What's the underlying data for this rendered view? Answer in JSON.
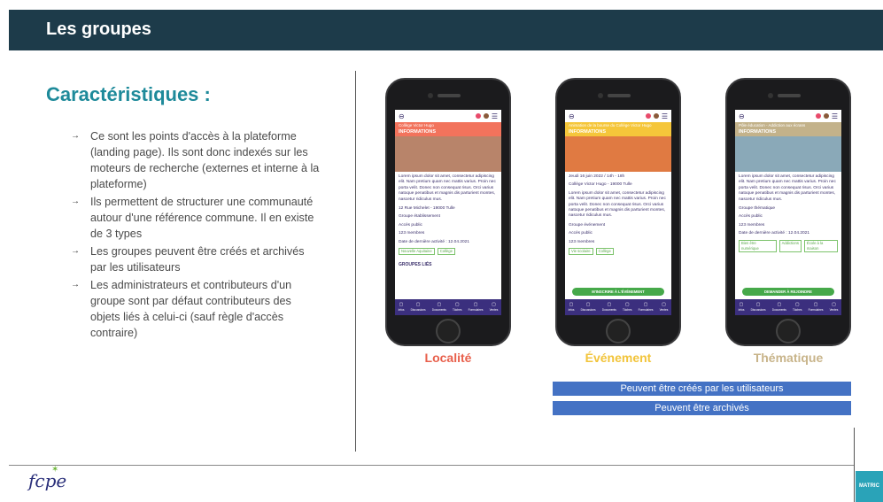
{
  "header": {
    "title": "Les groupes"
  },
  "section_title": "Caractéristiques :",
  "bullet_marker": "→",
  "bullets": [
    "Ce sont les points d'accès à la plateforme (landing page). Ils sont donc indexés sur les moteurs de recherche (externes et interne à la plateforme)",
    "Ils permettent de structurer une communauté autour d'une référence commune. Il en existe de 3 types",
    "Les groupes peuvent être créés et archivés par les utilisateurs",
    "Les administrateurs et contributeurs d'un groupe sont par défaut contributeurs des objets liés à celui-ci (sauf règle d'accès contraire)"
  ],
  "phones": [
    {
      "label": "Localité",
      "label_color": "#e8604c",
      "banner_color": "#f2735c",
      "crumb": "Collège Victor Hugo",
      "info": "INFORMATIONS",
      "image_color": "#b8846a",
      "lines": [
        "Lorem ipsum dolor sit amet, consectetur adipiscing elit. Nam pretium quam nec mattis varius. Proin nec porta velit. Donec non consequat risus. Orci varius natoque penatibus et magnis dis parturient montes, nascetur ridiculus mus."
      ],
      "meta": [
        "12 Rue Michelet - 19000 Tulle",
        "Groupe établissement",
        "Accès public",
        "123 membres",
        "Date de dernière activité : 12.04.2021"
      ],
      "tags": [
        "Nouvelle Aquitaine",
        "Collège"
      ],
      "extra": "GROUPES LIÉS",
      "cta": ""
    },
    {
      "label": "Événement",
      "label_color": "#f2c43a",
      "banner_color": "#f5c63a",
      "crumb": "Animation de la bourse du Collège Victor Hugo",
      "info": "INFORMATIONS",
      "image_color": "#e07a42",
      "lines": [
        "Jeudi 16 juin 2022 / 14h - 18h",
        "Collège Victor Hugo - 19000 Tulle",
        "Lorem ipsum dolor sit amet, consectetur adipiscing elit. Nam pretium quam nec mattis varius. Proin nec porta velit. Donec non consequat risus. Orci varius natoque penatibus et magnis dis parturient montes, nascetur ridiculus mus."
      ],
      "meta": [
        "Groupe événement",
        "Accès public",
        "123 membres"
      ],
      "tags": [
        "Vie scolaire",
        "Collège"
      ],
      "extra": "",
      "cta": "M'INSCRIRE À L'ÉVÉNEMENT"
    },
    {
      "label": "Thématique",
      "label_color": "#c8b48a",
      "banner_color": "#c3b28a",
      "crumb": "Pôle éducation - Addiction aux écrans",
      "info": "INFORMATIONS",
      "image_color": "#8aa9b8",
      "lines": [
        "Lorem ipsum dolor sit amet, consectetur adipiscing elit. Nam pretium quam nec mattis varius. Proin nec porta velit. Donec non consequat risus. Orci varius natoque penatibus et magnis dis parturient montes, nascetur ridiculus mus."
      ],
      "meta": [
        "Groupe thématique",
        "Accès public",
        "123 membres",
        "Date de dernière activité : 12.04.2021"
      ],
      "tags": [
        "Bien être numérique",
        "Addictions",
        "École à la maison"
      ],
      "extra": "",
      "cta": "DEMANDER À REJOINDRE"
    }
  ],
  "nav_items": [
    "Infos",
    "Discussions",
    "Documents",
    "Tâches",
    "Formulaires",
    "Ventes"
  ],
  "bars": [
    "Peuvent être créés par les utilisateurs",
    "Peuvent être archivés"
  ],
  "colors": {
    "header_bg": "#1d3b4a",
    "title": "#1e8a9a",
    "bar": "#4472c4",
    "nav": "#3b2f7e"
  },
  "footer": {
    "logo": "fcpe",
    "badge": "MATRIC"
  }
}
